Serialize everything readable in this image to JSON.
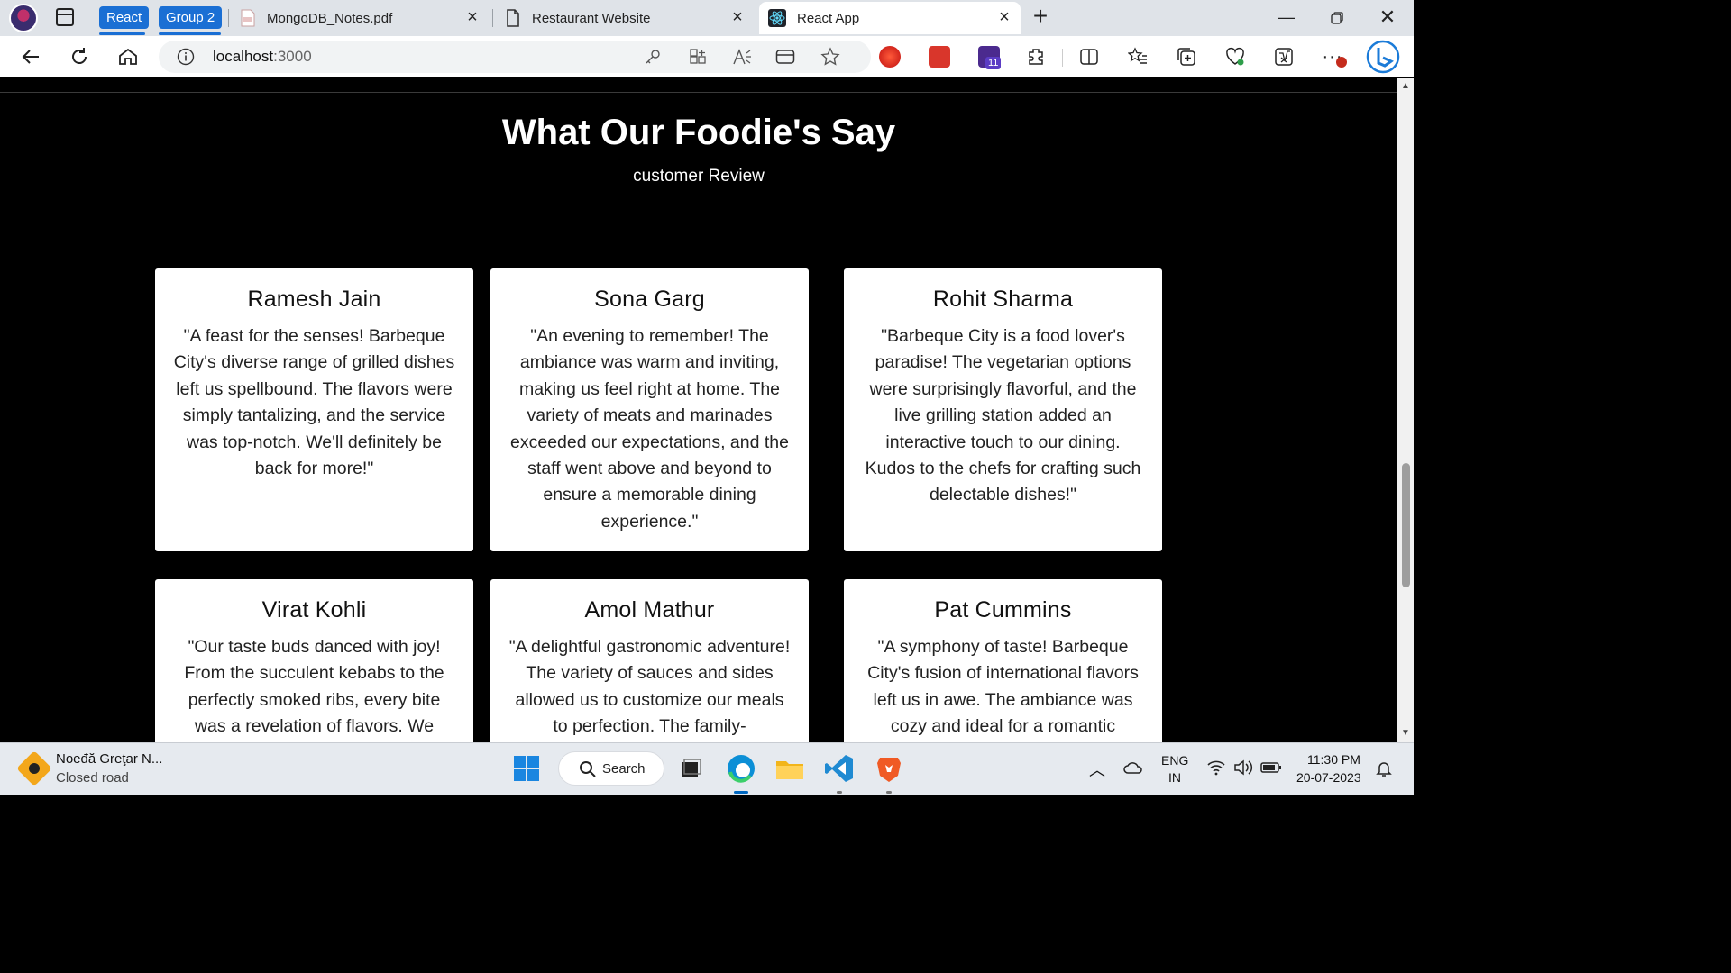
{
  "browser": {
    "tab_groups": [
      {
        "label": "React",
        "color": "#1a6fd4"
      },
      {
        "label": "Group 2",
        "color": "#1a6fd4"
      }
    ],
    "tabs": [
      {
        "title": "MongoDB_Notes.pdf",
        "icon": "pdf-icon"
      },
      {
        "title": "Restaurant Website",
        "icon": "page-icon"
      },
      {
        "title": "React App",
        "icon": "react-icon",
        "active": true
      }
    ],
    "address": {
      "host": "localhost",
      "port": ":3000"
    },
    "extension_badge": "11"
  },
  "page": {
    "title": "What Our Foodie's Say",
    "subtitle": "customer Review",
    "reviews": [
      {
        "name": "Ramesh Jain",
        "text": "\"A feast for the senses! Barbeque City's diverse range of grilled dishes left us spellbound. The flavors were simply tantalizing, and the service was top-notch. We'll definitely be back for more!\""
      },
      {
        "name": "Sona Garg",
        "text": "\"An evening to remember! The ambiance was warm and inviting, making us feel right at home. The variety of meats and marinades exceeded our expectations, and the staff went above and beyond to ensure a memorable dining experience.\""
      },
      {
        "name": "Rohit Sharma",
        "text": "\"Barbeque City is a food lover's paradise! The vegetarian options were surprisingly flavorful, and the live grilling station added an interactive touch to our dining. Kudos to the chefs for crafting such delectable dishes!\""
      },
      {
        "name": "Virat Kohli",
        "text": "\"Our taste buds danced with joy! From the succulent kebabs to the perfectly smoked ribs, every bite was a revelation of flavors. We"
      },
      {
        "name": "Amol Mathur",
        "text": "\"A delightful gastronomic adventure! The variety of sauces and sides allowed us to customize our meals to perfection. The family-"
      },
      {
        "name": "Pat Cummins",
        "text": "\"A symphony of taste! Barbeque City's fusion of international flavors left us in awe. The ambiance was cozy and ideal for a romantic"
      }
    ]
  },
  "taskbar": {
    "weather_title": "Noeđă Greţar N...",
    "weather_sub": "Closed road",
    "search_label": "Search",
    "lang_top": "ENG",
    "lang_bottom": "IN",
    "time": "11:30 PM",
    "date": "20-07-2023"
  }
}
